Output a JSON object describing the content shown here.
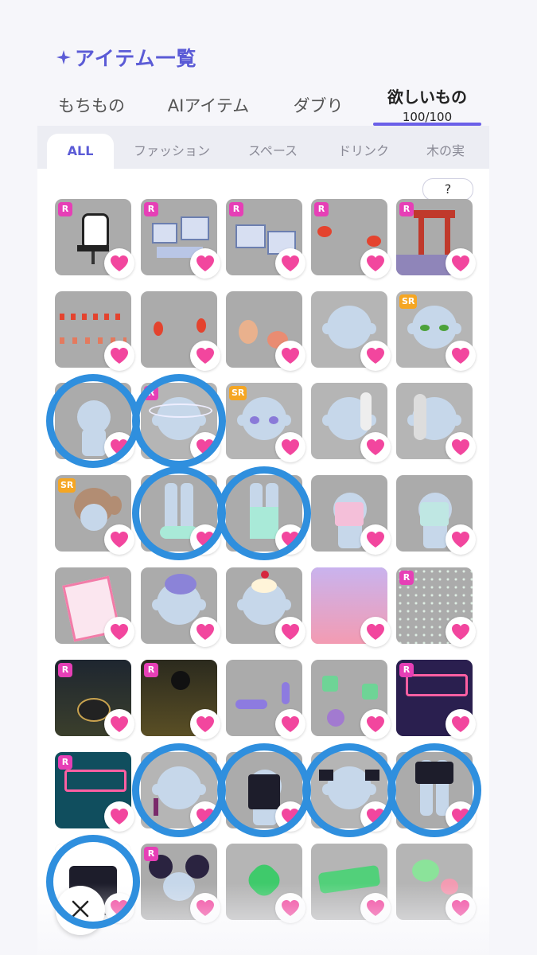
{
  "header": {
    "title": "アイテム一覧",
    "title_icon": "sparkle-icon"
  },
  "main_tabs": [
    {
      "label": "もちもの",
      "active": false
    },
    {
      "label": "AIアイテム",
      "active": false
    },
    {
      "label": "ダブり",
      "active": false
    },
    {
      "label": "欲しいもの",
      "count": "100/100",
      "active": true
    }
  ],
  "sub_tabs": [
    {
      "label": "ALL",
      "active": true
    },
    {
      "label": "ファッション",
      "active": false
    },
    {
      "label": "スペース",
      "active": false
    },
    {
      "label": "ドリンク",
      "active": false
    },
    {
      "label": "木の実",
      "active": false
    }
  ],
  "help_button": {
    "label": "?"
  },
  "colors": {
    "accent": "#5b5bd6",
    "tab_underline": "#6a5fe8",
    "heart": "#f2469e",
    "badge_r": "#e63fb6",
    "badge_sr": "#f5a623",
    "highlight_circle": "#2f8fde"
  },
  "items": [
    {
      "name": "gaming-chair",
      "rarity": "R",
      "favorited": true
    },
    {
      "name": "desk-monitors-set",
      "rarity": "R",
      "favorited": true
    },
    {
      "name": "monitor-setup",
      "rarity": "R",
      "favorited": true
    },
    {
      "name": "red-lanterns",
      "rarity": "R",
      "favorited": true
    },
    {
      "name": "chinese-gate",
      "rarity": "R",
      "favorited": true
    },
    {
      "name": "lantern-string-lights",
      "rarity": "",
      "favorited": true
    },
    {
      "name": "hanging-red-lanterns",
      "rarity": "",
      "favorited": true
    },
    {
      "name": "dumplings",
      "rarity": "",
      "favorited": true
    },
    {
      "name": "face-smile",
      "rarity": "",
      "favorited": true
    },
    {
      "name": "green-eyes",
      "rarity": "SR",
      "favorited": true
    },
    {
      "name": "green-leaf-outfit",
      "rarity": "",
      "favorited": true
    },
    {
      "name": "white-halo",
      "rarity": "R",
      "favorited": true
    },
    {
      "name": "purple-eyes",
      "rarity": "SR",
      "favorited": true
    },
    {
      "name": "white-hair",
      "rarity": "",
      "favorited": true
    },
    {
      "name": "silver-hair",
      "rarity": "",
      "favorited": true
    },
    {
      "name": "brown-twintail-hair",
      "rarity": "SR",
      "favorited": true
    },
    {
      "name": "mint-shoes",
      "rarity": "",
      "favorited": true
    },
    {
      "name": "mint-socks",
      "rarity": "",
      "favorited": true
    },
    {
      "name": "pink-outfit",
      "rarity": "",
      "favorited": true
    },
    {
      "name": "mint-outfit",
      "rarity": "",
      "favorited": true
    },
    {
      "name": "pink-notebook",
      "rarity": "",
      "favorited": true
    },
    {
      "name": "purple-bear-plush",
      "rarity": "",
      "favorited": true
    },
    {
      "name": "cherry-cream-hat",
      "rarity": "",
      "favorited": true
    },
    {
      "name": "pink-gradient-bg",
      "rarity": "",
      "favorited": true
    },
    {
      "name": "sparkle-bg",
      "rarity": "R",
      "favorited": true
    },
    {
      "name": "drum-stage",
      "rarity": "R",
      "favorited": true
    },
    {
      "name": "vocal-stage",
      "rarity": "R",
      "favorited": true
    },
    {
      "name": "purple-accessories",
      "rarity": "",
      "favorited": true
    },
    {
      "name": "green-stickers",
      "rarity": "",
      "favorited": true
    },
    {
      "name": "neon-chinatown-bg",
      "rarity": "R",
      "favorited": true
    },
    {
      "name": "teal-chinatown-bg",
      "rarity": "R",
      "favorited": true
    },
    {
      "name": "pearl-earring",
      "rarity": "",
      "favorited": true
    },
    {
      "name": "black-china-dress",
      "rarity": "",
      "favorited": true
    },
    {
      "name": "black-ribbon-bows",
      "rarity": "",
      "favorited": true
    },
    {
      "name": "black-shorts",
      "rarity": "",
      "favorited": true
    },
    {
      "name": "black-china-jacket",
      "rarity": "",
      "favorited": true
    },
    {
      "name": "black-bun-hair",
      "rarity": "R",
      "favorited": true
    },
    {
      "name": "green-clover",
      "rarity": "",
      "favorited": true
    },
    {
      "name": "green-sticker-text",
      "rarity": "",
      "favorited": true
    },
    {
      "name": "green-pink-hearts",
      "rarity": "",
      "favorited": true
    }
  ],
  "highlighted_items": [
    "green-leaf-outfit",
    "white-halo",
    "mint-shoes",
    "mint-socks",
    "pearl-earring",
    "black-china-dress",
    "black-ribbon-bows",
    "black-shorts",
    "black-china-jacket"
  ],
  "close_button": {
    "icon": "close-icon"
  }
}
